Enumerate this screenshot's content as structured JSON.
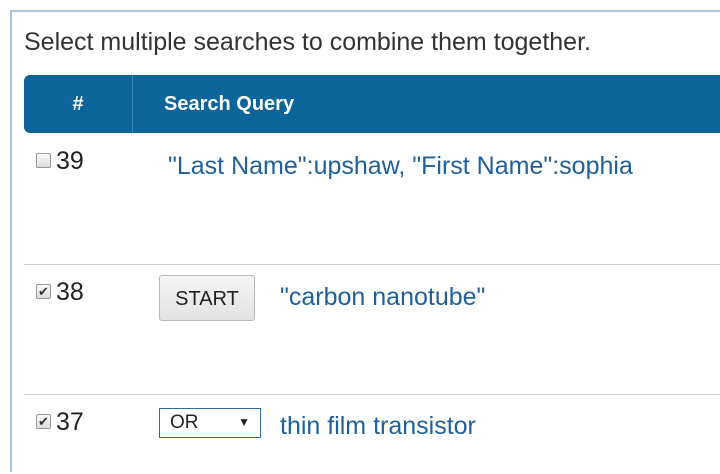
{
  "intro_text": "Select multiple searches to combine them together.",
  "table": {
    "headers": {
      "number": "#",
      "query": "Search Query"
    },
    "rows": [
      {
        "number": "39",
        "checked": false,
        "query": "\"Last Name\":upshaw, \"First Name\":sophia"
      },
      {
        "number": "38",
        "checked": true,
        "operator_button": "START",
        "query": "\"carbon nanotube\""
      },
      {
        "number": "37",
        "checked": true,
        "operator_select": "OR",
        "query": "thin film transistor"
      }
    ]
  },
  "icons": {
    "checkmark": "checkmark-icon",
    "dropdown": "caret-down-icon"
  },
  "colors": {
    "header_bg": "#0b659b",
    "link": "#1f5f9a",
    "frame_border": "#a9c4e0"
  }
}
